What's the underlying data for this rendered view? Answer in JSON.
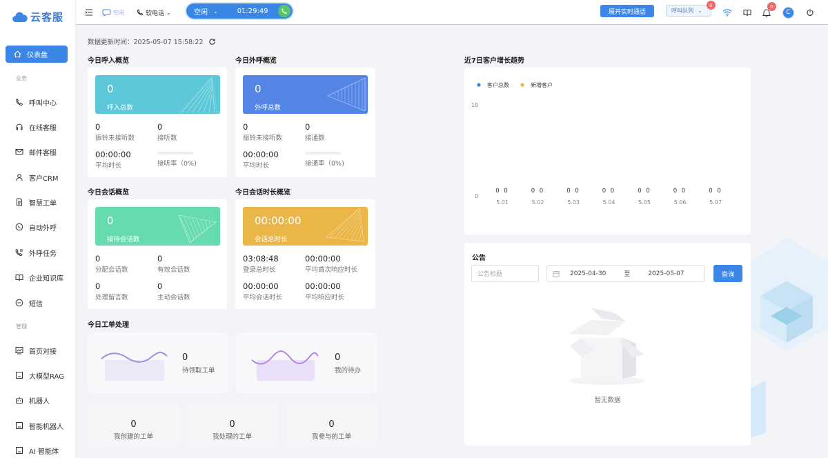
{
  "app": {
    "name": "云客服"
  },
  "sidebar": {
    "active": "仪表盘",
    "section_business": "业务",
    "section_manage": "管理",
    "items": [
      {
        "label": "呼叫中心",
        "icon": "phone-icon"
      },
      {
        "label": "在线客服",
        "icon": "headset-icon"
      },
      {
        "label": "邮件客服",
        "icon": "mail-icon"
      },
      {
        "label": "客户CRM",
        "icon": "user-icon"
      },
      {
        "label": "智慧工单",
        "icon": "document-icon"
      },
      {
        "label": "自动外呼",
        "icon": "whatsapp-icon"
      },
      {
        "label": "外呼任务",
        "icon": "phone-task-icon"
      },
      {
        "label": "企业知识库",
        "icon": "book-icon"
      },
      {
        "label": "短信",
        "icon": "message-icon"
      },
      {
        "label": "首页对接",
        "icon": "chart-icon"
      },
      {
        "label": "大模型RAG",
        "icon": "box-icon"
      },
      {
        "label": "机器人",
        "icon": "robot-icon"
      },
      {
        "label": "智能机器人",
        "icon": "box-icon"
      },
      {
        "label": "AI 智能体",
        "icon": "box-icon"
      }
    ]
  },
  "topbar": {
    "chat_status": "空闲",
    "softphone": "软电话",
    "agent_status": "空闲",
    "timer": "01:29:49",
    "expand_button": "展开实时通话",
    "queue": "呼叫队列",
    "queue_badge": "0",
    "bell_badge": "0",
    "avatar": "C"
  },
  "updated": {
    "label": "数据更新时间：",
    "value": "2025-05-07 15:58:22"
  },
  "inbound": {
    "title": "今日呼入概览",
    "total": "0",
    "total_label": "呼入总数",
    "stats": [
      {
        "v": "0",
        "k": "振铃未接听数"
      },
      {
        "v": "0",
        "k": "接听数"
      },
      {
        "v": "00:00:00",
        "k": "平均时长"
      },
      {
        "v": "",
        "k": "接听率（0%)",
        "progress": 0
      }
    ]
  },
  "outbound": {
    "title": "今日外呼概览",
    "total": "0",
    "total_label": "外呼总数",
    "stats": [
      {
        "v": "0",
        "k": "振铃未接听数"
      },
      {
        "v": "0",
        "k": "接通数"
      },
      {
        "v": "00:00:00",
        "k": "平均时长"
      },
      {
        "v": "",
        "k": "接通率（0%)",
        "progress": 0
      }
    ]
  },
  "session": {
    "title": "今日会话概览",
    "total": "0",
    "total_label": "接待会话数",
    "stats": [
      {
        "v": "0",
        "k": "分配会话数"
      },
      {
        "v": "0",
        "k": "有效会话数"
      },
      {
        "v": "0",
        "k": "处理留言数"
      },
      {
        "v": "0",
        "k": "主动会话数"
      }
    ]
  },
  "duration": {
    "title": "今日会话时长概览",
    "total": "00:00:00",
    "total_label": "会话总时长",
    "stats": [
      {
        "v": "03:08:48",
        "k": "登录总时长"
      },
      {
        "v": "00:00:00",
        "k": "平均首次响应时长"
      },
      {
        "v": "00:00:00",
        "k": "平均会话时长"
      },
      {
        "v": "00:00:00",
        "k": "平均响应时长"
      }
    ]
  },
  "workorder": {
    "title": "今日工单处理",
    "pending": {
      "v": "0",
      "k": "待领取工单"
    },
    "todo": {
      "v": "0",
      "k": "我的待办"
    },
    "created": {
      "v": "0",
      "k": "我创建的工单"
    },
    "handled": {
      "v": "0",
      "k": "我处理的工单"
    },
    "involved": {
      "v": "0",
      "k": "我参与的工单"
    }
  },
  "trend": {
    "title": "近7日客户增长趋势"
  },
  "chart_data": {
    "type": "bar",
    "categories": [
      "5.01",
      "5.02",
      "5.03",
      "5.04",
      "5.05",
      "5.06",
      "5.07"
    ],
    "series": [
      {
        "name": "客户总数",
        "values": [
          0,
          0,
          0,
          0,
          0,
          0,
          0
        ],
        "color": "#3b86e6"
      },
      {
        "name": "新增客户",
        "values": [
          0,
          0,
          0,
          0,
          0,
          0,
          0
        ],
        "color": "#f0b63c"
      }
    ],
    "ylim": [
      0,
      10
    ],
    "yticks": [
      "10",
      "0"
    ],
    "legend": "top-left"
  },
  "notice": {
    "title": "公告",
    "title_placeholder": "公告标题",
    "date_from": "2025-04-30",
    "date_sep": "至",
    "date_to": "2025-05-07",
    "query_button": "查询",
    "empty": "暂无数据"
  }
}
